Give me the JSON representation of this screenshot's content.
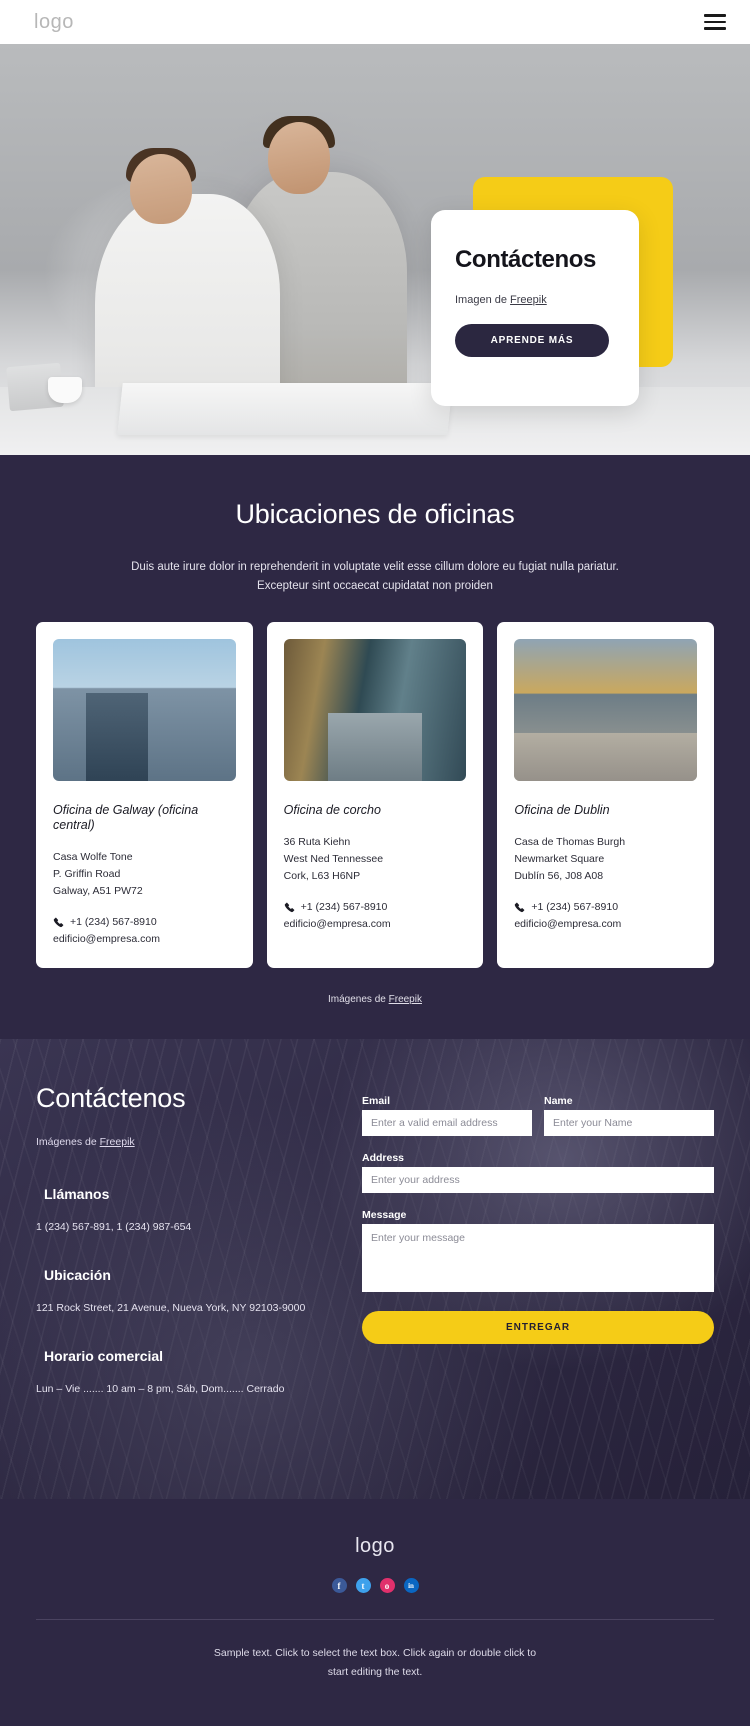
{
  "header": {
    "logo": "logo",
    "menu_icon": "hamburger-icon"
  },
  "hero": {
    "title": "Contáctenos",
    "credit_prefix": "Imagen de ",
    "credit_link": "Freepik",
    "cta_label": "APRENDE MÁS",
    "accent_color": "#f5cc17",
    "button_color": "#2b2740"
  },
  "locations": {
    "heading": "Ubicaciones de oficinas",
    "subtitle_line1": "Duis aute irure dolor in reprehenderit in voluptate velit esse cillum dolore eu fugiat nulla pariatur.",
    "subtitle_line2": "Excepteur sint occaecat cupidatat non proiden",
    "credit_prefix": "Imágenes de ",
    "credit_link": "Freepik",
    "background_color": "#2e2844",
    "cards": [
      {
        "image_name": "galway-office-photo",
        "title": "Oficina de Galway (oficina central)",
        "address": [
          "Casa Wolfe Tone",
          "P. Griffin Road",
          "Galway, A51 PW72"
        ],
        "phone": "+1 (234) 567-8910",
        "email": "edificio@empresa.com"
      },
      {
        "image_name": "cork-office-photo",
        "title": "Oficina de corcho",
        "address": [
          "36 Ruta Kiehn",
          "West Ned Tennessee",
          "Cork, L63 H6NP"
        ],
        "phone": "+1 (234) 567-8910",
        "email": "edificio@empresa.com"
      },
      {
        "image_name": "dublin-office-photo",
        "title": "Oficina de Dublin",
        "address": [
          "Casa de Thomas Burgh",
          "Newmarket Square",
          "Dublín 56, J08 A08"
        ],
        "phone": "+1 (234) 567-8910",
        "email": "edificio@empresa.com"
      }
    ]
  },
  "contact": {
    "heading": "Contáctenos",
    "credit_prefix": "Imágenes de ",
    "credit_link": "Freepik",
    "blocks": [
      {
        "title": "Llámanos",
        "text": "1 (234) 567-891, 1 (234) 987-654"
      },
      {
        "title": "Ubicación",
        "text": "121 Rock Street, 21 Avenue, Nueva York, NY 92103-9000"
      },
      {
        "title": "Horario comercial",
        "text": "Lun – Vie ....... 10 am – 8 pm, Sáb, Dom....... Cerrado"
      }
    ],
    "form": {
      "email_label": "Email",
      "email_placeholder": "Enter a valid email address",
      "email_value": "",
      "name_label": "Name",
      "name_placeholder": "Enter your Name",
      "name_value": "",
      "address_label": "Address",
      "address_placeholder": "Enter your address",
      "address_value": "",
      "message_label": "Message",
      "message_placeholder": "Enter your message",
      "message_value": "",
      "submit_label": "ENTREGAR",
      "submit_color": "#f5cc17"
    }
  },
  "footer": {
    "logo": "logo",
    "socials": [
      {
        "name": "facebook-icon",
        "glyph": "f",
        "color": "#3b5998"
      },
      {
        "name": "twitter-icon",
        "glyph": "t",
        "color": "#3ea1ec"
      },
      {
        "name": "instagram-icon",
        "glyph": "o",
        "color": "#e1306c"
      },
      {
        "name": "linkedin-icon",
        "glyph": "in",
        "color": "#0a66c2"
      }
    ],
    "text_line1": "Sample text. Click to select the text box. Click again or double click to",
    "text_line2": "start editing the text."
  }
}
